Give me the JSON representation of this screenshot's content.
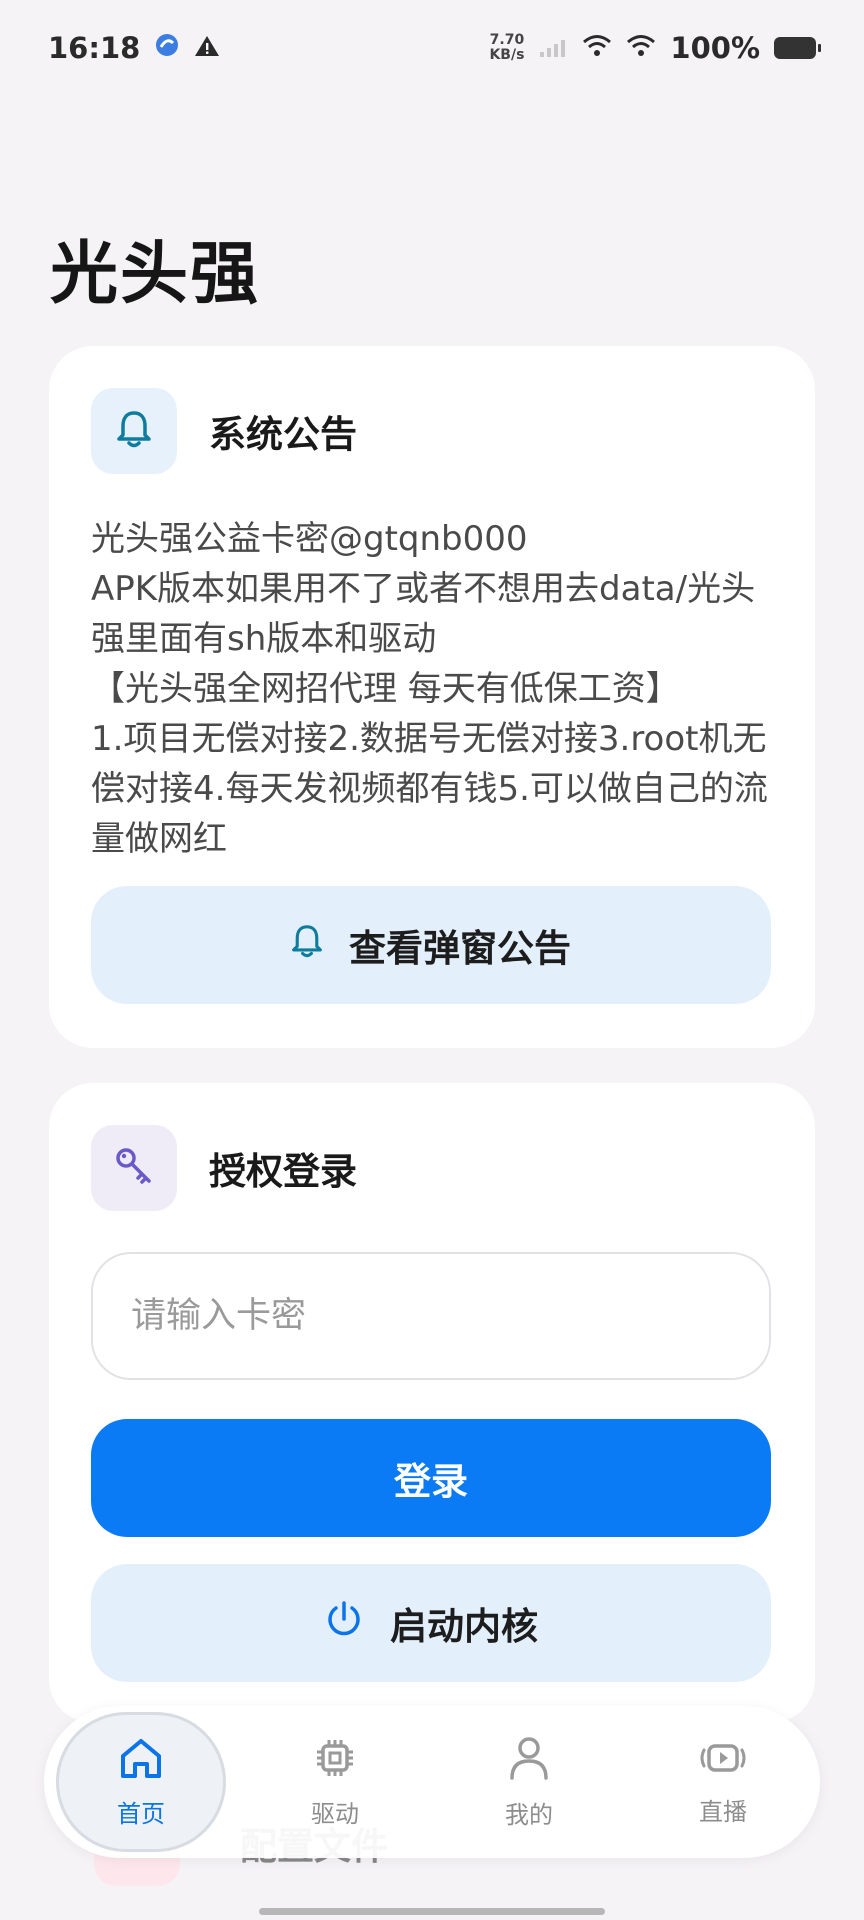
{
  "status": {
    "time": "16:18",
    "net_speed_value": "7.70",
    "net_speed_unit": "KB/s",
    "battery": "100%"
  },
  "app": {
    "title": "光头强"
  },
  "notice": {
    "title": "系统公告",
    "body": "光头强公益卡密@gtqnb000\nAPK版本如果用不了或者不想用去data/光头强里面有sh版本和驱动\n【光头强全网招代理 每天有低保工资】\n1.项目无偿对接2.数据号无偿对接3.root机无偿对接4.每天发视频都有钱5.可以做自己的流量做网红",
    "popup_button": "查看弹窗公告"
  },
  "auth": {
    "title": "授权登录",
    "input_placeholder": "请输入卡密",
    "input_value": "",
    "login_button": "登录",
    "kernel_button": "启动内核"
  },
  "next_card": {
    "title": "配置文件"
  },
  "nav": {
    "items": [
      {
        "label": "首页",
        "icon": "home-icon",
        "active": true
      },
      {
        "label": "驱动",
        "icon": "chip-icon",
        "active": false
      },
      {
        "label": "我的",
        "icon": "person-icon",
        "active": false
      },
      {
        "label": "直播",
        "icon": "live-icon",
        "active": false
      }
    ]
  },
  "colors": {
    "primary": "#0a7af5",
    "nav_active": "#0a74e8",
    "background": "#f6f3f7"
  }
}
